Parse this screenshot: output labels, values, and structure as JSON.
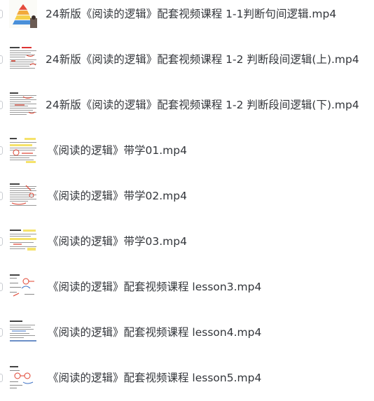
{
  "files": [
    {
      "name": "24新版《阅读的逻辑》配套视频课程 1-1判断句间逻辑.mp4",
      "thumb_icon": "pyramid-slide-thumbnail"
    },
    {
      "name": "24新版《阅读的逻辑》配套视频课程 1-2 判断段间逻辑(上).mp4",
      "thumb_icon": "document-page-thumbnail"
    },
    {
      "name": "24新版《阅读的逻辑》配套视频课程 1-2 判断段间逻辑(下).mp4",
      "thumb_icon": "document-page-thumbnail"
    },
    {
      "name": "《阅读的逻辑》带学01.mp4",
      "thumb_icon": "annotated-page-thumbnail"
    },
    {
      "name": "《阅读的逻辑》带学02.mp4",
      "thumb_icon": "annotated-page-thumbnail"
    },
    {
      "name": "《阅读的逻辑》带学03.mp4",
      "thumb_icon": "annotated-page-thumbnail"
    },
    {
      "name": "《阅读的逻辑》配套视频课程 lesson3.mp4",
      "thumb_icon": "whiteboard-thumbnail"
    },
    {
      "name": "《阅读的逻辑》配套视频课程 lesson4.mp4",
      "thumb_icon": "whiteboard-thumbnail"
    },
    {
      "name": "《阅读的逻辑》配套视频课程 lesson5.mp4",
      "thumb_icon": "whiteboard-thumbnail"
    }
  ],
  "colors": {
    "text": "#33363b",
    "checkbox_border": "#c9ccd1",
    "annotation_red": "#e0402e",
    "highlight_yellow": "#f5e26a",
    "pyramid_top": "#e54b3c",
    "pyramid_mid": "#f2a93b",
    "pyramid_base": "#4a90d9"
  }
}
